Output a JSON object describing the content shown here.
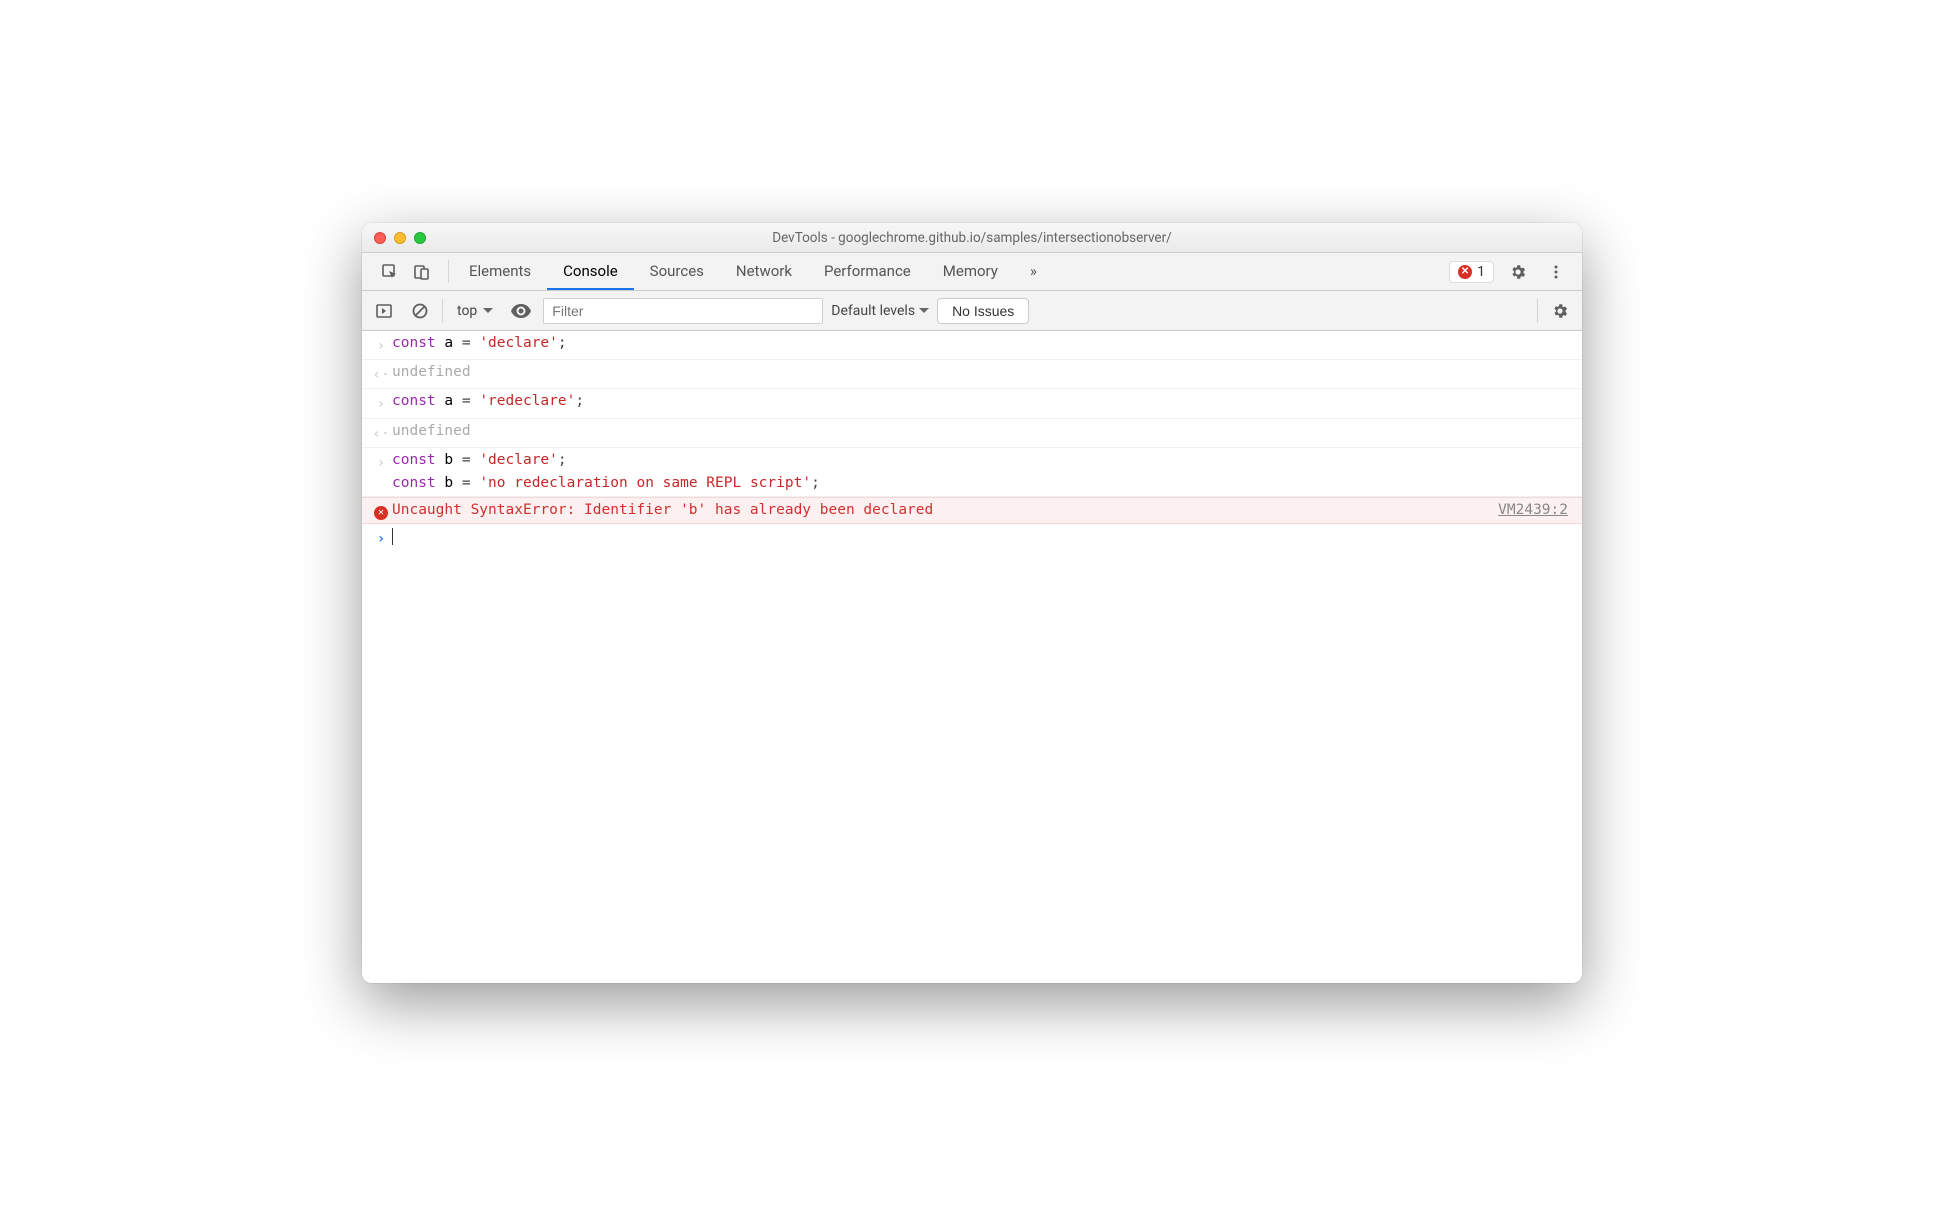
{
  "window": {
    "title": "DevTools - googlechrome.github.io/samples/intersectionobserver/"
  },
  "tabs": {
    "elements": "Elements",
    "console": "Console",
    "sources": "Sources",
    "network": "Network",
    "performance": "Performance",
    "memory": "Memory",
    "more": "»"
  },
  "errorCount": "1",
  "filter": {
    "context": "top",
    "placeholder": "Filter",
    "levels": "Default levels",
    "issues": "No Issues"
  },
  "code": {
    "kw_const": "const",
    "id_a": "a",
    "id_b": "b",
    "op_eq": " = ",
    "semi": ";",
    "str_declare": "'declare'",
    "str_redeclare": "'redeclare'",
    "str_noredec": "'no redeclaration on same REPL script'"
  },
  "out": {
    "undefined": "undefined"
  },
  "error": {
    "msg": "Uncaught SyntaxError: Identifier 'b' has already been declared",
    "src": "VM2439:2"
  }
}
